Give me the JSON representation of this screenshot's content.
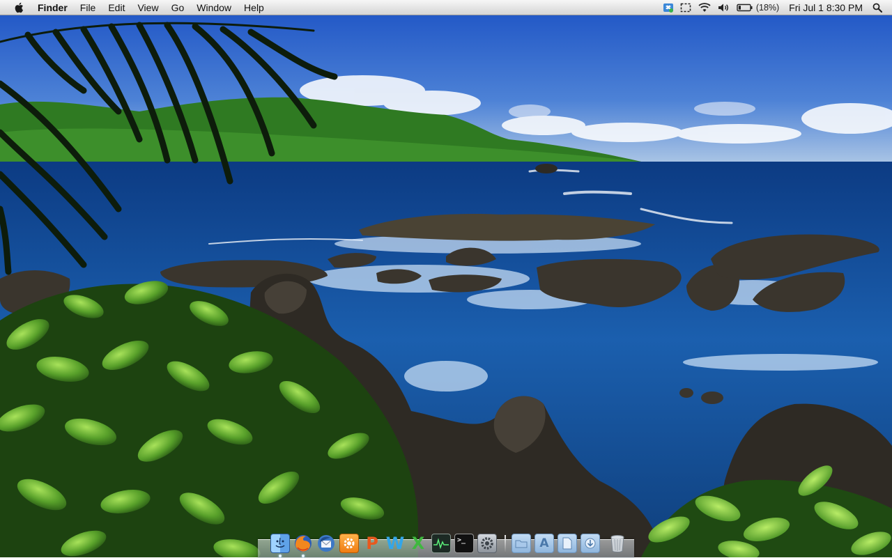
{
  "menubar": {
    "apple_icon": "apple-logo-icon",
    "app_name": "Finder",
    "menus": [
      "File",
      "Edit",
      "View",
      "Go",
      "Window",
      "Help"
    ],
    "status_icons": [
      "dropbox-icon",
      "screen-selection-icon",
      "wifi-icon",
      "volume-icon",
      "battery-icon"
    ],
    "battery_percent": "(18%)",
    "date_time": "Fri Jul 1  8:30 PM",
    "search_icon": "spotlight-search-icon"
  },
  "dock": {
    "apps": [
      {
        "name": "finder-icon"
      },
      {
        "name": "firefox-icon"
      },
      {
        "name": "thunderbird-icon"
      },
      {
        "name": "settings-app-icon"
      },
      {
        "name": "powerpoint-icon",
        "glyph": "P"
      },
      {
        "name": "word-icon",
        "glyph": "W"
      },
      {
        "name": "excel-icon",
        "glyph": "X"
      },
      {
        "name": "activity-monitor-icon"
      },
      {
        "name": "terminal-icon",
        "glyph": ">_"
      },
      {
        "name": "system-preferences-icon"
      }
    ],
    "folders": [
      {
        "name": "documents-folder-icon"
      },
      {
        "name": "applications-folder-icon",
        "glyph": "A"
      },
      {
        "name": "files-folder-icon"
      },
      {
        "name": "downloads-folder-icon"
      }
    ],
    "trash": {
      "name": "trash-icon"
    }
  },
  "colors": {
    "sky_top": "#1f57c8",
    "sky_horizon": "#a9c6e6",
    "ocean_deep": "#0b3e86",
    "ocean_mid": "#1e64b0",
    "foliage": "#5aa02c",
    "rock": "#3a352e"
  }
}
